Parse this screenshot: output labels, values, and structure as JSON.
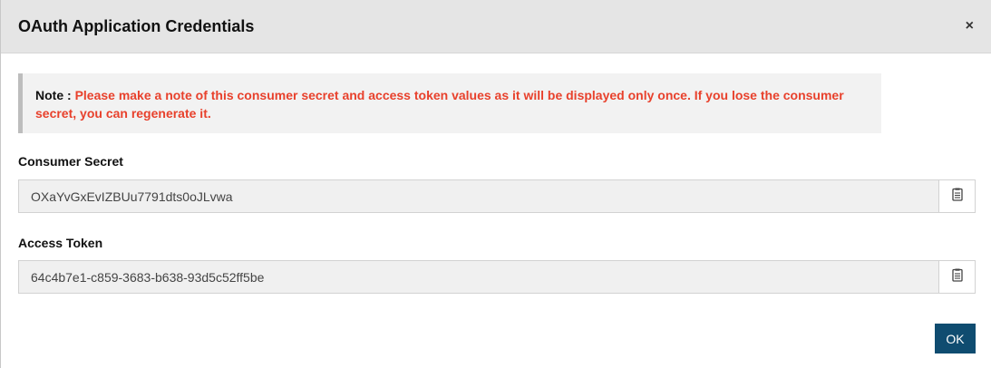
{
  "dialog": {
    "title": "OAuth Application Credentials",
    "close_symbol": "×"
  },
  "note": {
    "label": "Note : ",
    "text": "Please make a note of this consumer secret and access token values as it will be displayed only once. If you lose the consumer secret, you can regenerate it."
  },
  "fields": {
    "consumer_secret": {
      "label": "Consumer Secret",
      "value": "OXaYvGxEvIZBUu7791dts0oJLvwa",
      "copy_icon": "clipboard-icon"
    },
    "access_token": {
      "label": "Access Token",
      "value": "64c4b7e1-c859-3683-b638-93d5c52ff5be",
      "copy_icon": "clipboard-icon"
    }
  },
  "footer": {
    "ok_label": "OK"
  },
  "colors": {
    "header_bg": "#e5e5e5",
    "note_bg": "#f2f2f2",
    "note_text": "#e8412c",
    "primary_button": "#0f4c70"
  }
}
